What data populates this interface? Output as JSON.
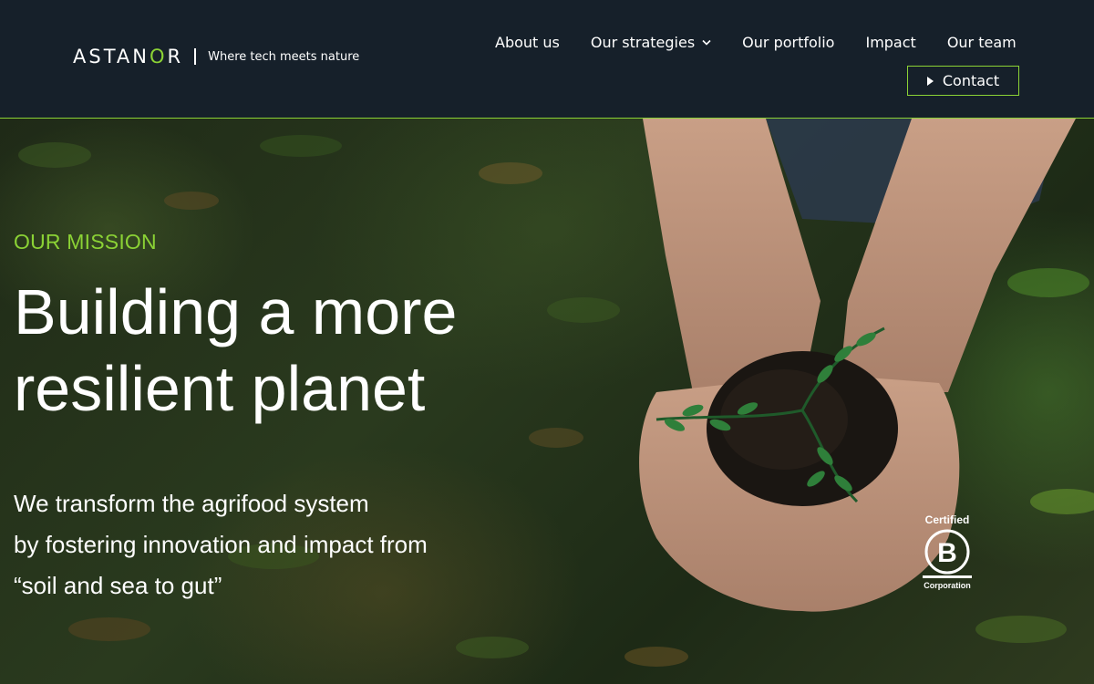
{
  "header": {
    "logo_prefix": "AST",
    "logo_letter_a": "A",
    "logo_letter_n": "N",
    "logo_o": "O",
    "logo_suffix": "R",
    "tagline": "Where tech meets nature",
    "nav": {
      "about": "About us",
      "strategies": "Our strategies",
      "portfolio": "Our portfolio",
      "impact": "Impact",
      "team": "Our team"
    },
    "contact_label": "Contact"
  },
  "hero": {
    "eyebrow": "OUR MISSION",
    "headline_line1": "Building a more",
    "headline_line2": "resilient planet",
    "lede_line1": "We transform the agrifood system",
    "lede_line2": "by fostering innovation and impact from",
    "lede_line3": "“soil and sea to gut”"
  },
  "badge": {
    "certified": "Certified",
    "corporation": "Corporation",
    "mark": "B"
  },
  "colors": {
    "header_bg": "#16202a",
    "accent": "#8bd235",
    "text": "#ffffff"
  },
  "icons": [
    "chevron-down-icon",
    "play-triangle-icon",
    "b-corp-logo"
  ]
}
